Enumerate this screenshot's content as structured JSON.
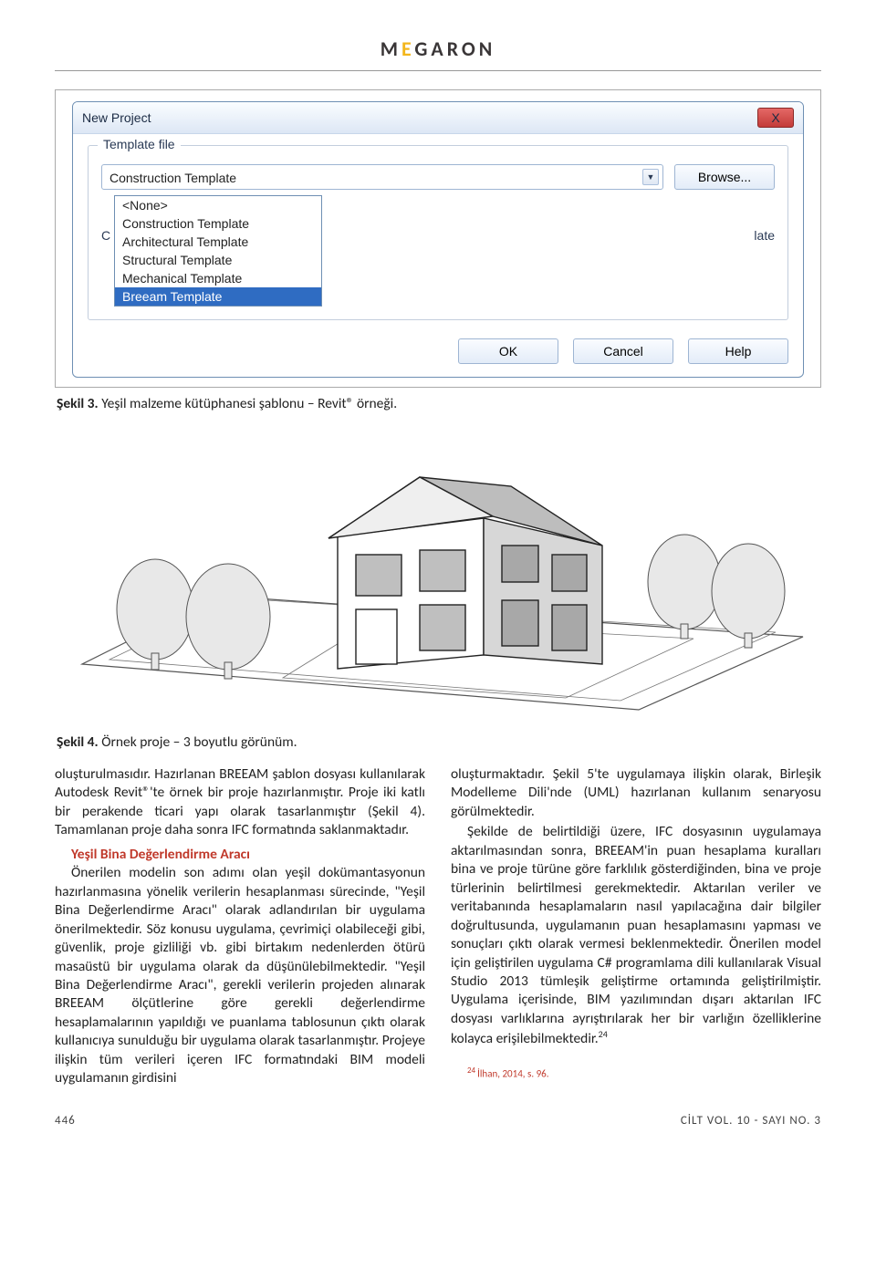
{
  "header": {
    "brand_pre": "M",
    "brand_mid": "E",
    "brand_post": "GARON"
  },
  "dialog": {
    "title": "New Project",
    "close_glyph": "X",
    "group_label": "Template file",
    "combo_value": "Construction Template",
    "combo_arrow": "▼",
    "browse_label": "Browse...",
    "options": [
      "<None>",
      "Construction Template",
      "Architectural Template",
      "Structural Template",
      "Mechanical Template",
      "Breeam Template"
    ],
    "cut_prefix": "C",
    "hint_label": "late",
    "ok_label": "OK",
    "cancel_label": "Cancel",
    "help_label": "Help"
  },
  "fig3_caption_b": "Şekil 3.",
  "fig3_caption_t": " Yeşil malzeme kütüphanesi şablonu – Revit® örneği.",
  "fig4_caption_b": "Şekil 4.",
  "fig4_caption_t": " Örnek proje – 3 boyutlu görünüm.",
  "col1": {
    "p1": "oluşturulmasıdır. Hazırlanan BREEAM şablon dosyası kullanılarak Autodesk Revit®'te örnek bir proje hazırlanmıştır. Proje iki katlı bir perakende ticari yapı olarak tasarlanmıştır (Şekil 4). Tamamlanan proje daha sonra IFC formatında saklanmaktadır.",
    "h": "Yeşil Bina Değerlendirme Aracı",
    "p2": "Önerilen modelin son adımı olan yeşil dokümantasyonun hazırlanmasına yönelik verilerin hesaplanması sürecinde, \"Yeşil Bina Değerlendirme Aracı\" olarak adlandırılan bir uygulama önerilmektedir. Söz konusu uygulama, çevrimiçi olabileceği gibi, güvenlik, proje gizliliği vb. gibi birtakım nedenlerden ötürü masaüstü bir uygulama olarak da düşünülebilmektedir. \"Yeşil Bina Değerlendirme Aracı\", gerekli verilerin projeden alınarak BREEAM ölçütlerine göre gerekli değerlendirme hesaplamalarının yapıldığı ve puanlama tablosunun çıktı olarak kullanıcıya sunulduğu bir uygulama olarak tasarlanmıştır. Projeye ilişkin tüm verileri içeren IFC formatındaki BIM modeli uygulamanın girdisini"
  },
  "col2": {
    "p1": "oluşturmaktadır. Şekil 5'te uygulamaya ilişkin olarak, Birleşik Modelleme Dili'nde (UML) hazırlanan kullanım senaryosu görülmektedir.",
    "p2": "Şekilde de belirtildiği üzere, IFC dosyasının uygulamaya aktarılmasından sonra, BREEAM'in puan hesaplama kuralları bina ve proje türüne göre farklılık gösterdiğinden, bina ve proje türlerinin belirtilmesi gerekmektedir. Aktarılan veriler ve veritabanında hesaplamaların nasıl yapılacağına dair bilgiler doğrultusunda, uygulamanın puan hesaplamasını yapması ve sonuçları çıktı olarak vermesi beklenmektedir. Önerilen model için geliştirilen uygulama C# programlama dili kullanılarak Visual Studio 2013 tümleşik geliştirme ortamında geliştirilmiştir. Uygulama içerisinde, BIM yazılımından dışarı aktarılan IFC dosyası varlıklarına ayrıştırılarak her bir varlığın özelliklerine kolayca erişilebilmektedir.",
    "sup24": "24",
    "footnote": "İlhan, 2014, s. 96."
  },
  "footer": {
    "page": "446",
    "vol": "CİLT VOL. 10 - SAYI NO. 3"
  }
}
